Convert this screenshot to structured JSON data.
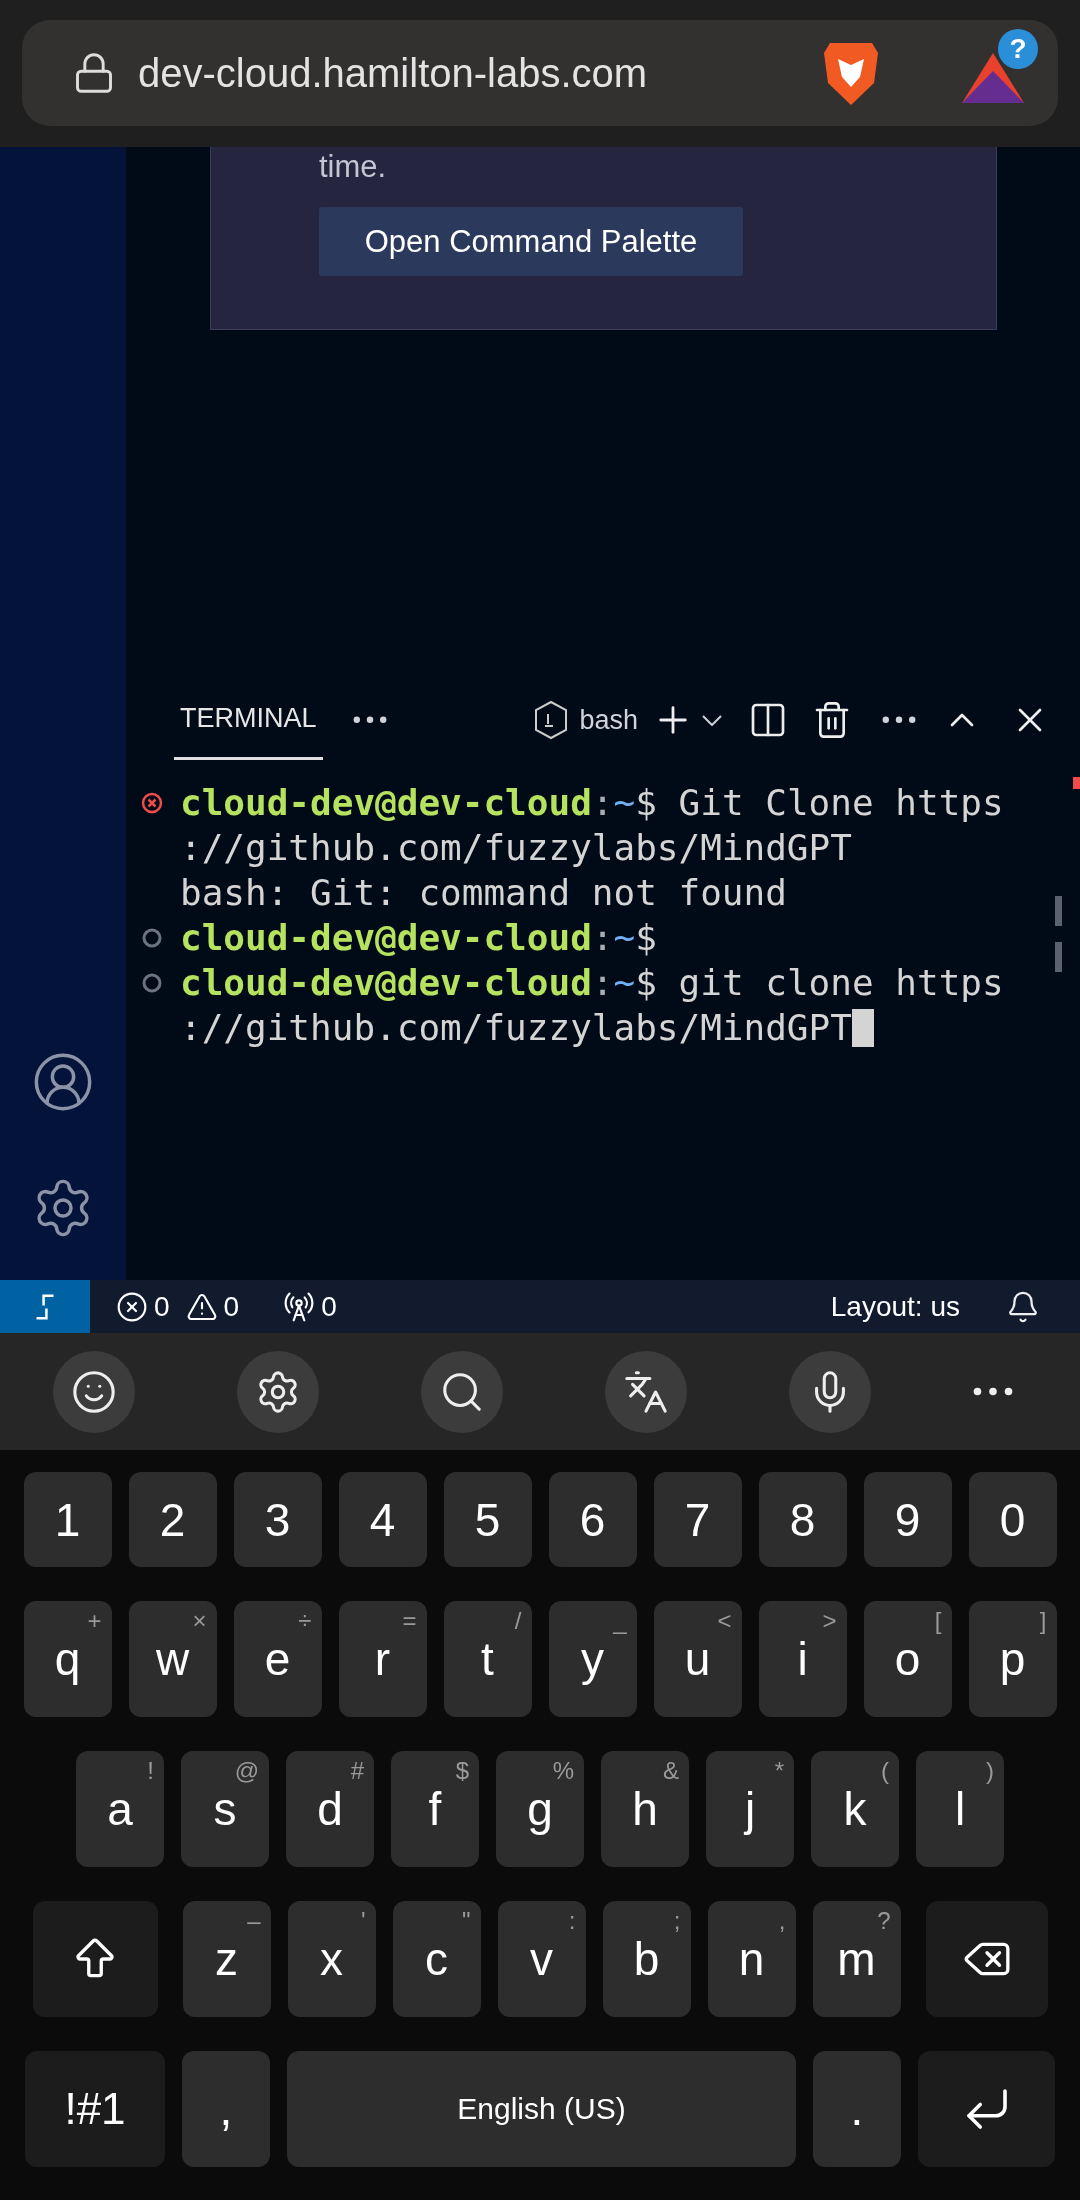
{
  "browser": {
    "url": "dev-cloud.hamilton-labs.com",
    "badge": "?"
  },
  "dialog": {
    "text": "time.",
    "button": "Open Command Palette"
  },
  "terminal": {
    "tabs": [
      {
        "label": "TERMINAL",
        "selected": true
      }
    ],
    "shell": "bash",
    "lines": [
      {
        "kind": "prompt",
        "failed": true,
        "user": "cloud-dev@dev-cloud",
        "sep": ":",
        "path": "~",
        "symbol": "$",
        "command": " Git Clone https"
      },
      {
        "kind": "output",
        "text": "://github.com/fuzzylabs/MindGPT"
      },
      {
        "kind": "output",
        "text": "bash: Git: command not found"
      },
      {
        "kind": "prompt",
        "failed": false,
        "user": "cloud-dev@dev-cloud",
        "sep": ":",
        "path": "~",
        "symbol": "$"
      },
      {
        "kind": "prompt",
        "failed": false,
        "user": "cloud-dev@dev-cloud",
        "sep": ":",
        "path": "~",
        "symbol": "$",
        "command": " git clone https"
      },
      {
        "kind": "output",
        "text": "://github.com/fuzzylabs/MindGPT",
        "cursor": true
      }
    ]
  },
  "status_bar": {
    "errors": "0",
    "warnings": "0",
    "ports": "0",
    "layout": "Layout: us"
  },
  "keyboard": {
    "keys": [
      {
        "kind": "char",
        "label": "1"
      },
      {
        "kind": "char",
        "label": "2"
      },
      {
        "kind": "char",
        "label": "3"
      },
      {
        "kind": "char",
        "label": "4"
      },
      {
        "kind": "char",
        "label": "5"
      },
      {
        "kind": "char",
        "label": "6"
      },
      {
        "kind": "char",
        "label": "7"
      },
      {
        "kind": "char",
        "label": "8"
      },
      {
        "kind": "char",
        "label": "9"
      },
      {
        "kind": "char",
        "label": "0"
      },
      {
        "kind": "break"
      },
      {
        "kind": "char",
        "label": "q",
        "hint": "+"
      },
      {
        "kind": "char",
        "label": "w",
        "hint": "×"
      },
      {
        "kind": "char",
        "label": "e",
        "hint": "÷"
      },
      {
        "kind": "char",
        "label": "r",
        "hint": "="
      },
      {
        "kind": "char",
        "label": "t",
        "hint": "/"
      },
      {
        "kind": "char",
        "label": "y",
        "hint": "_"
      },
      {
        "kind": "char",
        "label": "u",
        "hint": "<"
      },
      {
        "kind": "char",
        "label": "i",
        "hint": ">"
      },
      {
        "kind": "char",
        "label": "o",
        "hint": "["
      },
      {
        "kind": "char",
        "label": "p",
        "hint": "]"
      },
      {
        "kind": "break"
      },
      {
        "kind": "char",
        "label": "a",
        "hint": "!"
      },
      {
        "kind": "char",
        "label": "s",
        "hint": "@"
      },
      {
        "kind": "char",
        "label": "d",
        "hint": "#"
      },
      {
        "kind": "char",
        "label": "f",
        "hint": "$"
      },
      {
        "kind": "char",
        "label": "g",
        "hint": "%"
      },
      {
        "kind": "char",
        "label": "h",
        "hint": "&"
      },
      {
        "kind": "char",
        "label": "j",
        "hint": "*"
      },
      {
        "kind": "char",
        "label": "k",
        "hint": "("
      },
      {
        "kind": "char",
        "label": "l",
        "hint": ")"
      },
      {
        "kind": "break"
      },
      {
        "kind": "shift"
      },
      {
        "kind": "char",
        "label": "z",
        "hint": "–"
      },
      {
        "kind": "char",
        "label": "x",
        "hint": "'"
      },
      {
        "kind": "char",
        "label": "c",
        "hint": "\""
      },
      {
        "kind": "char",
        "label": "v",
        "hint": ":"
      },
      {
        "kind": "char",
        "label": "b",
        "hint": ";"
      },
      {
        "kind": "char",
        "label": "n",
        "hint": ","
      },
      {
        "kind": "char",
        "label": "m",
        "hint": "?"
      },
      {
        "kind": "backspace"
      },
      {
        "kind": "break"
      },
      {
        "kind": "symbols",
        "label": "!#1"
      },
      {
        "kind": "char",
        "label": ","
      },
      {
        "kind": "space",
        "label": "English (US)"
      },
      {
        "kind": "char",
        "label": "."
      },
      {
        "kind": "enter"
      }
    ]
  }
}
